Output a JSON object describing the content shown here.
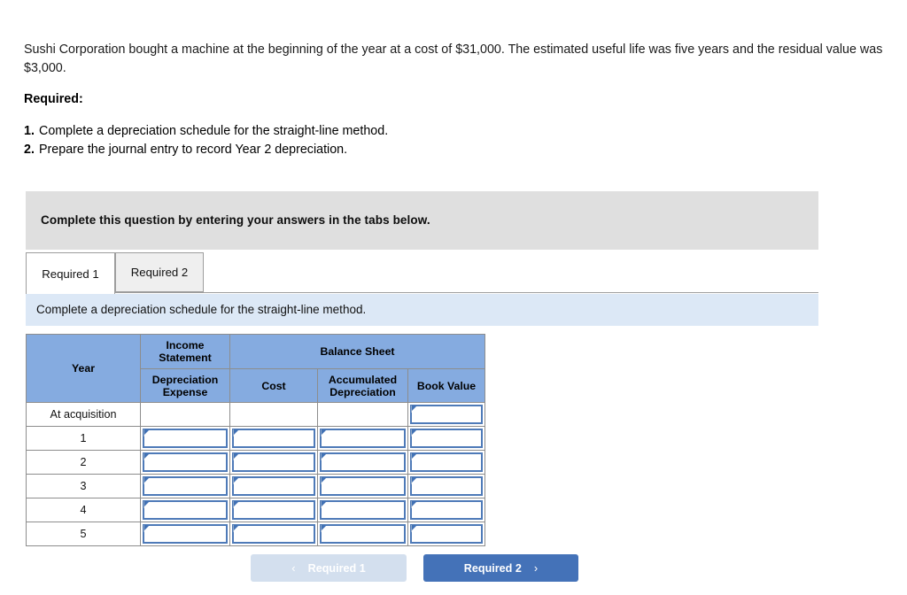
{
  "problem": {
    "stem": "Sushi Corporation bought a machine at the beginning of the year at a cost of $31,000. The estimated useful life was five years and the residual value was $3,000.",
    "required_heading": "Required:",
    "requirements": [
      {
        "number": "1.",
        "text": "Complete a depreciation schedule for the straight-line method."
      },
      {
        "number": "2.",
        "text": "Prepare the journal entry to record Year 2 depreciation."
      }
    ]
  },
  "instruction_banner": {
    "text": "Complete this question by entering your answers in the tabs below."
  },
  "tabs": [
    {
      "label": "Required 1",
      "active": true
    },
    {
      "label": "Required 2",
      "active": false
    }
  ],
  "sub_instruction": {
    "text": "Complete a depreciation schedule for the straight-line method."
  },
  "table": {
    "header": {
      "year": "Year",
      "income_statement": "Income Statement",
      "balance_sheet": "Balance Sheet",
      "depreciation_expense": "Depreciation Expense",
      "cost": "Cost",
      "accumulated_depreciation": "Accumulated Depreciation",
      "book_value": "Book Value"
    },
    "rows": [
      {
        "year": "At acquisition",
        "depreciation_expense": "",
        "cost": "",
        "accumulated_depreciation": "",
        "book_value": ""
      },
      {
        "year": "1",
        "depreciation_expense": "",
        "cost": "",
        "accumulated_depreciation": "",
        "book_value": ""
      },
      {
        "year": "2",
        "depreciation_expense": "",
        "cost": "",
        "accumulated_depreciation": "",
        "book_value": ""
      },
      {
        "year": "3",
        "depreciation_expense": "",
        "cost": "",
        "accumulated_depreciation": "",
        "book_value": ""
      },
      {
        "year": "4",
        "depreciation_expense": "",
        "cost": "",
        "accumulated_depreciation": "",
        "book_value": ""
      },
      {
        "year": "5",
        "depreciation_expense": "",
        "cost": "",
        "accumulated_depreciation": "",
        "book_value": ""
      }
    ]
  },
  "nav": {
    "prev_label": "Required 1",
    "next_label": "Required 2",
    "prev_chevron": "‹",
    "next_chevron": "›"
  },
  "colors": {
    "table_header_blue": "#85abe0",
    "input_border_blue": "#4e7ab8",
    "banner_gray": "#dfdfdf",
    "sub_instruction_blue": "#dce8f6",
    "primary_button_blue": "#4472b8",
    "disabled_button_blue": "#d3dfee"
  }
}
